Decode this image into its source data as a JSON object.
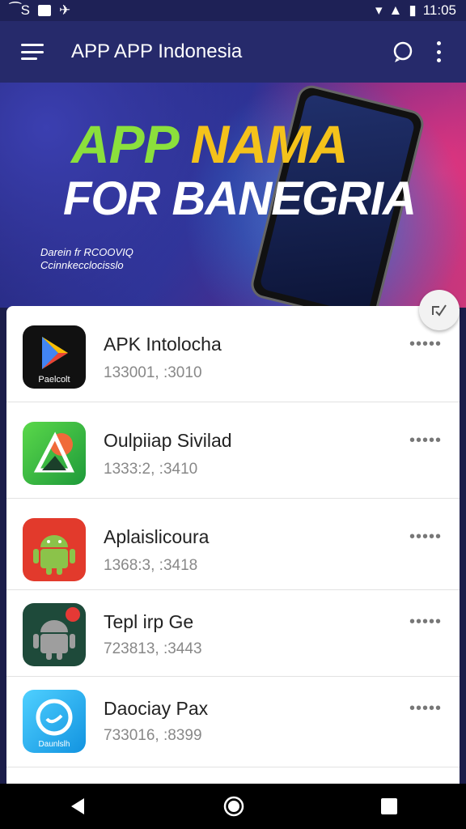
{
  "status_bar": {
    "left_text": "⁀S",
    "time": "11:05"
  },
  "app_bar": {
    "title": "APP APP Indonesia",
    "menu_icon": "hamburger-menu-icon",
    "chat_icon": "chat-bubble-icon",
    "more_icon": "more-vert-icon"
  },
  "banner": {
    "headline_word1": "APP",
    "headline_word2": "NAMA",
    "subheadline": "FOR BANEGRIA",
    "small_line1": "Darein fr RCOOVIQ",
    "small_line2": "Ccinnkecclocisslo"
  },
  "fab": {
    "icon": "edit-check-icon"
  },
  "apps": [
    {
      "name": "APK Intolocha",
      "meta": "133001, :3010",
      "icon_label": "Paelcolt",
      "more": "•••••"
    },
    {
      "name": "Oulpiiap Sivilad",
      "meta": "1333:2, :3410",
      "icon_label": "",
      "more": "•••••"
    },
    {
      "name": "Aplaislicoura",
      "meta": "1368:3, :3418",
      "icon_label": "",
      "more": "•••••"
    },
    {
      "name": "Tepl irp Ge",
      "meta": "723813, :3443",
      "icon_label": "",
      "more": "•••••"
    },
    {
      "name": "Daociay Pax",
      "meta": "733016, :8399",
      "icon_label": "Daunlslh",
      "more": "•••••"
    }
  ],
  "colors": {
    "app_bar": "#262a6b",
    "status_bar": "#1e2156",
    "headline_green": "#8be03c",
    "headline_yellow": "#f4c21b"
  }
}
